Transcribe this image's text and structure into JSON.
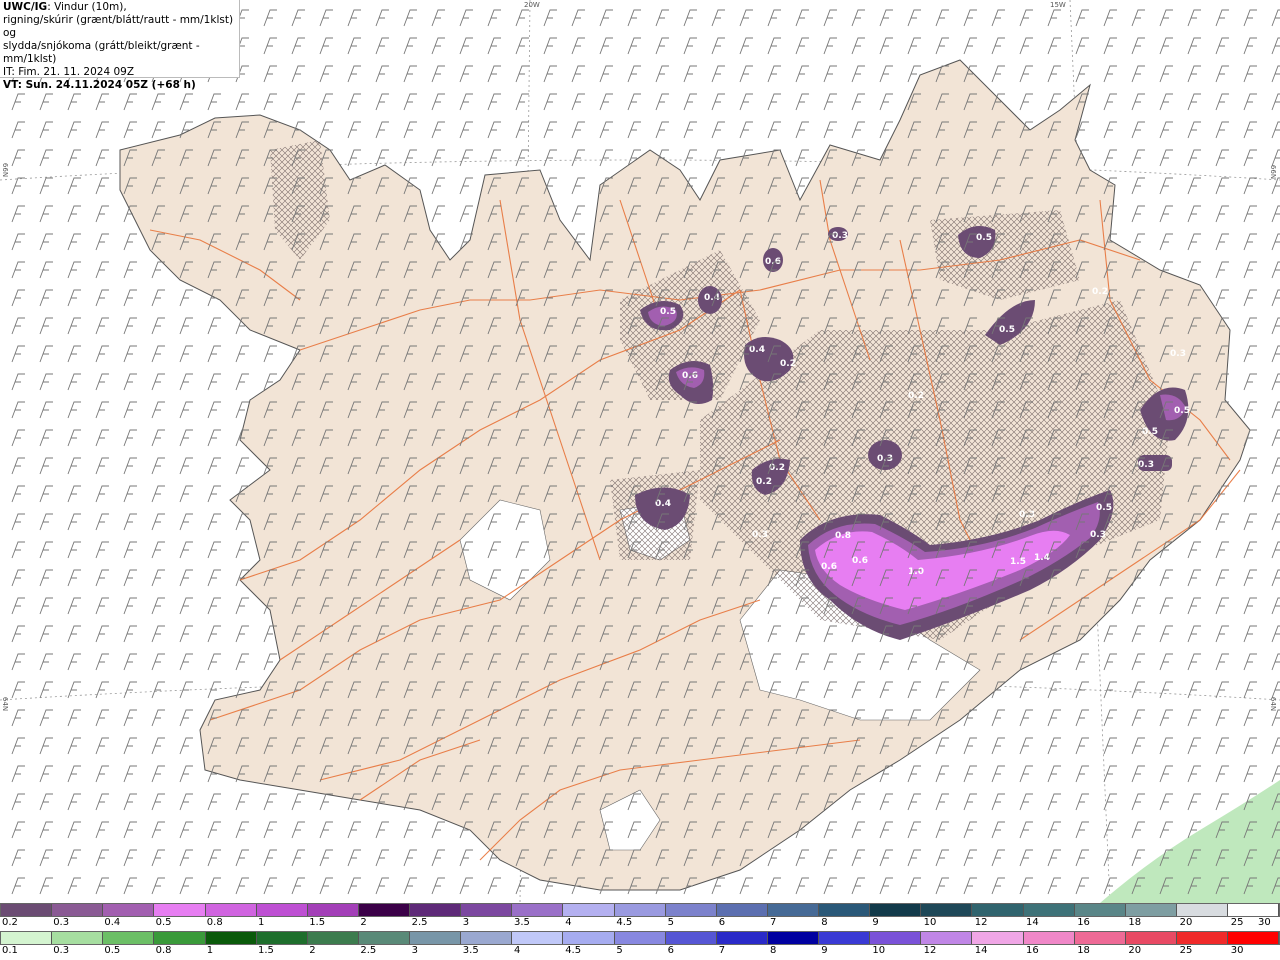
{
  "header": {
    "model": "UWC/IG",
    "desc1": ": Vindur (10m),",
    "desc2": "rigning/skúrir (grænt/blátt/rautt - mm/1klst) og",
    "desc3": "slydda/snjókoma (grátt/bleikt/grænt - mm/1klst)",
    "init_time": "IT: Fim. 21. 11. 2024 09Z",
    "valid_time": "VT: Sun. 24.11.2024 05Z (+68 h)"
  },
  "grid_labels": {
    "lon_20w": "20W",
    "lon_15w": "15W",
    "lat_66n_left": "66N",
    "lat_66n_right": "66N",
    "lat_64n_left": "64N",
    "lat_64n_right": "64N"
  },
  "precip_labels": [
    "0.5",
    "0.4",
    "0.6",
    "0.3",
    "0.5",
    "0.5",
    "0.4",
    "0.2",
    "0.6",
    "0.2",
    "0.3",
    "0.2",
    "0.2",
    "0.4",
    "0.5",
    "0.5",
    "0.3",
    "0.3",
    "0.8",
    "0.6",
    "0.6",
    "1.0",
    "1.5",
    "1.4",
    "0.3",
    "0.5",
    "0.3",
    "0.2",
    "0.3"
  ],
  "scale_top": {
    "colors": [
      "#6b4c73",
      "#8a5a94",
      "#a25fb0",
      "#e77ef2",
      "#d064e0",
      "#be50d3",
      "#a33fb8",
      "#3b0048",
      "#5e2a78",
      "#7c48a0",
      "#9a70c8",
      "#b4b0f0",
      "#9a9ae0",
      "#7c82cc",
      "#5c6fb0",
      "#466a96",
      "#2a5878",
      "#123a4a",
      "#1e4858",
      "#30646e",
      "#3e7278",
      "#5a8688",
      "#7e9ea2",
      "#d8dce0",
      "#ffffff"
    ],
    "labels": [
      "0.2",
      "0.3",
      "0.4",
      "0.5",
      "0.8",
      "1",
      "1.5",
      "2",
      "2.5",
      "3",
      "3.5",
      "4",
      "4.5",
      "5",
      "6",
      "7",
      "8",
      "9",
      "10",
      "12",
      "14",
      "16",
      "18",
      "20",
      "25",
      "30"
    ]
  },
  "scale_bottom": {
    "colors": [
      "#d4f4d0",
      "#a6dea0",
      "#6cbf66",
      "#3a9a3a",
      "#0a5a0a",
      "#1e6e2c",
      "#3c7c4e",
      "#5a8a78",
      "#7896a8",
      "#9aa8d0",
      "#c0c8f8",
      "#a6acf0",
      "#8888e0",
      "#5656d4",
      "#2a2ac8",
      "#0000a0",
      "#3a3ad4",
      "#7a52d8",
      "#c086e6",
      "#f0a6e6",
      "#f088c8",
      "#ee6a96",
      "#e84a64",
      "#f02a2a",
      "#ff0000"
    ],
    "labels": [
      "0.1",
      "0.3",
      "0.5",
      "0.8",
      "1",
      "1.5",
      "2",
      "2.5",
      "3",
      "3.5",
      "4",
      "4.5",
      "5",
      "6",
      "7",
      "8",
      "9",
      "10",
      "12",
      "14",
      "16",
      "18",
      "20",
      "25",
      "30"
    ]
  },
  "colors": {
    "land": "#f2e4d6",
    "roads": "#e8743a",
    "hatch": "#6a5a5a",
    "precip_light": "#6b4c73",
    "precip_mid": "#a25fb0",
    "precip_heavy": "#e77ef2",
    "rain_green": "#bfe8bd",
    "wind_barb": "#777777"
  }
}
